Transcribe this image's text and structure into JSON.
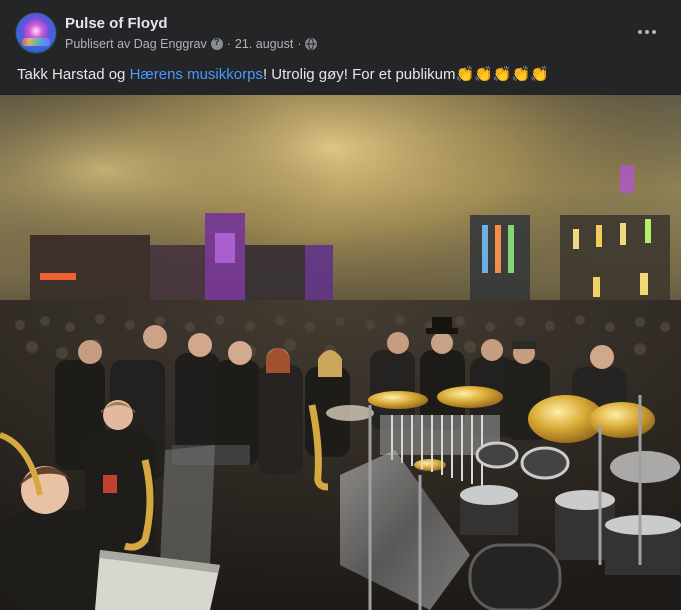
{
  "post": {
    "page_name": "Pulse of Floyd",
    "published_by": "Publisert av Dag Enggrav",
    "date": "21. august",
    "separator": "·",
    "text_part1": "Takk Harstad og ",
    "link_text": "Hærens musikkorps",
    "text_part2": "! Utrolig gøy! For et publikum",
    "emoji": "👏👏👏👏👏"
  },
  "icons": {
    "info": "info-icon",
    "audience": "globe-icon",
    "more": "more-options-icon"
  },
  "colors": {
    "background": "#242526",
    "text_primary": "#e4e6eb",
    "text_secondary": "#b0b3b8",
    "link": "#4599ff"
  }
}
